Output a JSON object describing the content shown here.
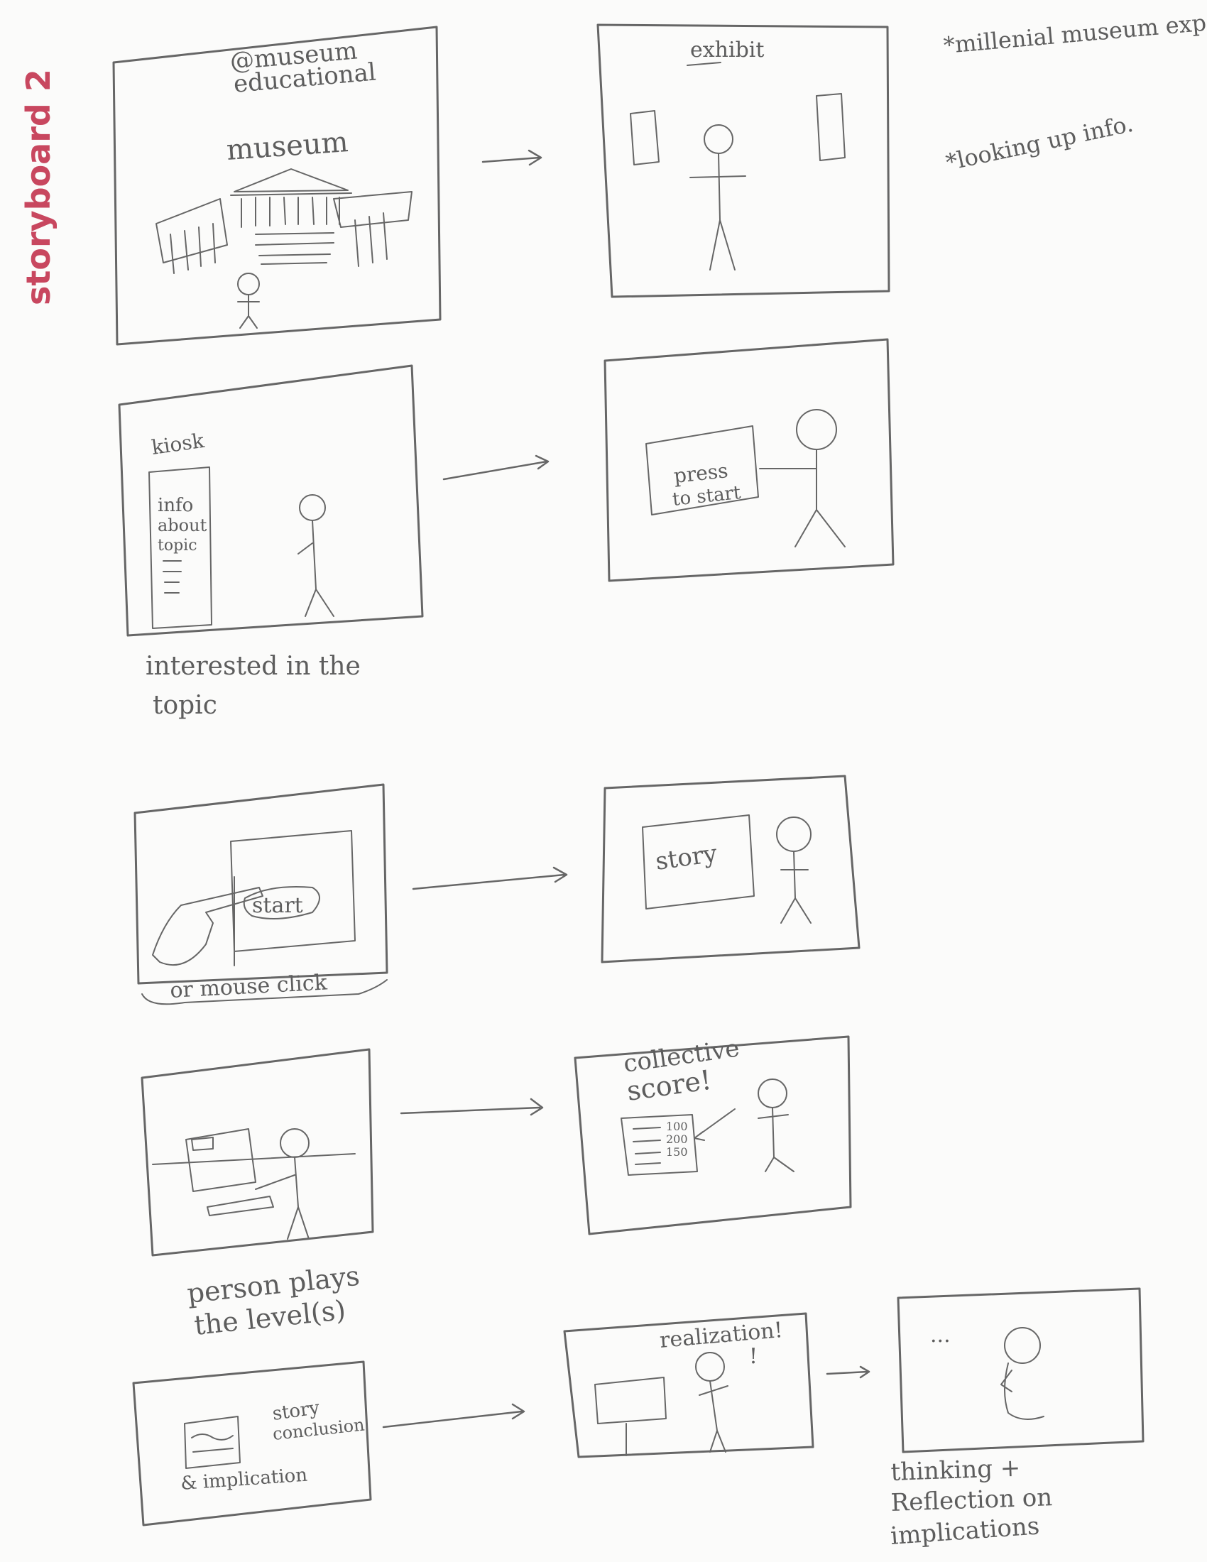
{
  "title": "storyboard 2",
  "notes": [
    "*millenial museum experience",
    "*looking up info."
  ],
  "frames": [
    {
      "id": "f1",
      "texts": [
        "@museum",
        "educational",
        "museum"
      ]
    },
    {
      "id": "f2",
      "texts": [
        "exhibit"
      ]
    },
    {
      "id": "f3",
      "texts": [
        "kiosk",
        "info",
        "about",
        "topic"
      ],
      "caption": [
        "interested in the",
        "topic"
      ]
    },
    {
      "id": "f4",
      "texts": [
        "press",
        "to start"
      ]
    },
    {
      "id": "f5",
      "texts": [
        "start"
      ],
      "caption": [
        "or mouse click"
      ]
    },
    {
      "id": "f6",
      "texts": [
        "story"
      ]
    },
    {
      "id": "f7",
      "texts": [],
      "caption": [
        "person plays",
        "the level(s)"
      ]
    },
    {
      "id": "f8",
      "texts": [
        "collective",
        "score!",
        "100",
        "200",
        "150"
      ]
    },
    {
      "id": "f9",
      "texts": [
        "story",
        "conclusion",
        "& implication"
      ]
    },
    {
      "id": "f10",
      "texts": [
        "realization!",
        "!"
      ]
    },
    {
      "id": "f11",
      "texts": [
        "..."
      ],
      "caption": [
        "thinking +",
        "Reflection on",
        "implications"
      ]
    }
  ]
}
